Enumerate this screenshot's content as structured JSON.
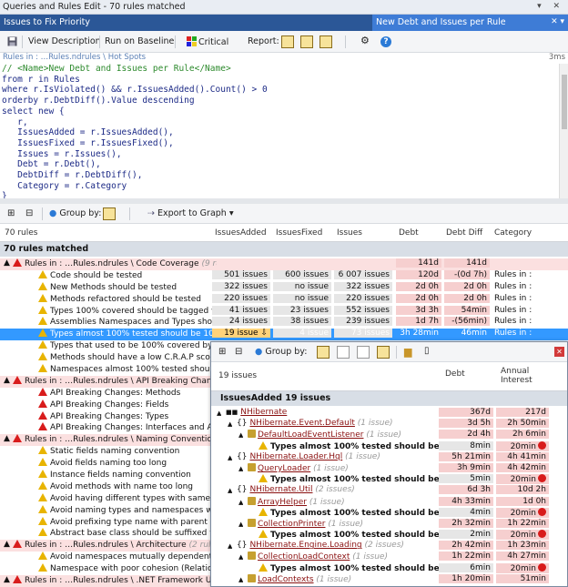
{
  "window": {
    "title": "Queries and Rules Edit  - 70 rules matched",
    "icons": "▾ ✕"
  },
  "tabs": {
    "left": "Issues to Fix Priority",
    "right": "New Debt and Issues per Rule",
    "right_icons": "✕ ▾"
  },
  "toolbar": {
    "save": "",
    "view_description": "View Description",
    "run_on_baseline": "Run on Baseline",
    "critical": "Critical",
    "report": "Report:"
  },
  "breadcrumb": {
    "path": "Rules in : …Rules.ndrules \\ Hot Spots",
    "time": "3ms"
  },
  "code": {
    "lines": [
      {
        "t": "cmt",
        "s": "// <Name>New Debt and Issues per Rule</Name>"
      },
      {
        "t": "",
        "s": "from r in Rules"
      },
      {
        "t": "",
        "s": "where r.IsViolated() && r.IssuesAdded().Count() > 0"
      },
      {
        "t": "",
        "s": "orderby r.DebtDiff().Value descending"
      },
      {
        "t": "",
        "s": "select new {"
      },
      {
        "t": "",
        "s": "   r,"
      },
      {
        "t": "",
        "s": "   IssuesAdded = r.IssuesAdded(),"
      },
      {
        "t": "",
        "s": "   IssuesFixed = r.IssuesFixed(),"
      },
      {
        "t": "",
        "s": "   Issues = r.Issues(),"
      },
      {
        "t": "",
        "s": "   Debt = r.Debt(),"
      },
      {
        "t": "",
        "s": "   DebtDiff = r.DebtDiff(),"
      },
      {
        "t": "",
        "s": "   Category = r.Category"
      },
      {
        "t": "",
        "s": "}"
      }
    ]
  },
  "results_toolbar": {
    "group_by": "Group by:",
    "export": "Export to Graph",
    "export_arrow": "▾"
  },
  "columns": {
    "rules": "70 rules",
    "added": "IssuesAdded",
    "fixed": "IssuesFixed",
    "issues": "Issues",
    "debt": "Debt",
    "debtdiff": "Debt Diff",
    "category": "Category"
  },
  "group_label": "70 rules matched",
  "rows": [
    {
      "ind": 0,
      "exp": "▲",
      "icon": "red",
      "name": "Rules in : …Rules.ndrules \\ Code Coverage",
      "extra": "(9 rules)",
      "a": "",
      "f": "",
      "i": "",
      "d": "141d",
      "dd": "141d",
      "cat": "",
      "pink": true
    },
    {
      "ind": 1,
      "exp": "",
      "icon": "warn",
      "name": "Code should be tested",
      "a": "501 issues",
      "f": "600 issues",
      "i": "6 007 issues",
      "d": "120d",
      "dd": "-(0d 7h)",
      "cat": "Rules in :"
    },
    {
      "ind": 1,
      "exp": "",
      "icon": "warn",
      "name": "New Methods should be tested",
      "a": "322 issues",
      "f": "no issue",
      "i": "322 issues",
      "d": "2d 0h",
      "dd": "2d 0h",
      "cat": "Rules in :"
    },
    {
      "ind": 1,
      "exp": "",
      "icon": "warn",
      "name": "Methods refactored should be tested",
      "a": "220 issues",
      "f": "no issue",
      "i": "220 issues",
      "d": "2d 0h",
      "dd": "2d 0h",
      "cat": "Rules in :"
    },
    {
      "ind": 1,
      "exp": "",
      "icon": "warn",
      "name": "Types 100% covered should be tagged with Fu",
      "a": "41 issues",
      "f": "23 issues",
      "i": "552 issues",
      "d": "3d 3h",
      "dd": "54min",
      "cat": "Rules in :"
    },
    {
      "ind": 1,
      "exp": "",
      "icon": "warn",
      "name": "Assemblies Namespaces and Types should be",
      "a": "24 issues",
      "f": "38 issues",
      "i": "239 issues",
      "d": "1d 7h",
      "dd": "-(56min)",
      "cat": "Rules in :"
    },
    {
      "ind": 1,
      "exp": "",
      "icon": "warn",
      "name": "Types almost 100% tested should be 100% te",
      "a": "19 issue ⇩",
      "f": "4 issue",
      "i": "73 issues",
      "d": "3h 28min",
      "dd": "46min",
      "cat": "Rules in :",
      "sel": true
    },
    {
      "ind": 1,
      "exp": "",
      "icon": "warn",
      "name": "Types that used to be 100% covered by tests s",
      "a": "",
      "f": "",
      "i": "",
      "d": "",
      "dd": "",
      "cat": ""
    },
    {
      "ind": 1,
      "exp": "",
      "icon": "warn",
      "name": "Methods should have a low C.R.A.P score",
      "a": "",
      "f": "",
      "i": "",
      "d": "",
      "dd": "",
      "cat": ""
    },
    {
      "ind": 1,
      "exp": "",
      "icon": "warn",
      "name": "Namespaces almost 100% tested should be 1",
      "a": "",
      "f": "",
      "i": "",
      "d": "",
      "dd": "",
      "cat": ""
    },
    {
      "ind": 0,
      "exp": "▲",
      "icon": "red",
      "name": "Rules in : …Rules.ndrules \\ API Breaking Changes",
      "extra": "",
      "a": "",
      "f": "",
      "i": "",
      "d": "",
      "dd": "",
      "cat": "",
      "pink": true
    },
    {
      "ind": 1,
      "exp": "",
      "icon": "red",
      "name": "API Breaking Changes: Methods",
      "a": "",
      "f": "",
      "i": "",
      "d": "",
      "dd": "",
      "cat": ""
    },
    {
      "ind": 1,
      "exp": "",
      "icon": "red",
      "name": "API Breaking Changes: Fields",
      "a": "",
      "f": "",
      "i": "",
      "d": "",
      "dd": "",
      "cat": ""
    },
    {
      "ind": 1,
      "exp": "",
      "icon": "red",
      "name": "API Breaking Changes: Types",
      "a": "",
      "f": "",
      "i": "",
      "d": "",
      "dd": "",
      "cat": ""
    },
    {
      "ind": 1,
      "exp": "",
      "icon": "red",
      "name": "API Breaking Changes: Interfaces and Abstrac",
      "a": "",
      "f": "",
      "i": "",
      "d": "",
      "dd": "",
      "cat": ""
    },
    {
      "ind": 0,
      "exp": "▲",
      "icon": "red",
      "name": "Rules in : …Rules.ndrules \\ Naming Conventions",
      "extra": "",
      "a": "",
      "f": "",
      "i": "",
      "d": "",
      "dd": "",
      "cat": "",
      "pink": true
    },
    {
      "ind": 1,
      "exp": "",
      "icon": "warn",
      "name": "Static fields naming convention",
      "a": "",
      "f": "",
      "i": "",
      "d": "",
      "dd": "",
      "cat": ""
    },
    {
      "ind": 1,
      "exp": "",
      "icon": "warn",
      "name": "Avoid fields naming too long",
      "a": "",
      "f": "",
      "i": "",
      "d": "",
      "dd": "",
      "cat": ""
    },
    {
      "ind": 1,
      "exp": "",
      "icon": "warn",
      "name": "Instance fields naming convention",
      "a": "",
      "f": "",
      "i": "",
      "d": "",
      "dd": "",
      "cat": ""
    },
    {
      "ind": 1,
      "exp": "",
      "icon": "warn",
      "name": "Avoid methods with name too long",
      "a": "",
      "f": "",
      "i": "",
      "d": "",
      "dd": "",
      "cat": ""
    },
    {
      "ind": 1,
      "exp": "",
      "icon": "warn",
      "name": "Avoid having different types with same name",
      "a": "",
      "f": "",
      "i": "",
      "d": "",
      "dd": "",
      "cat": ""
    },
    {
      "ind": 1,
      "exp": "",
      "icon": "warn",
      "name": "Avoid naming types and namespaces with the s",
      "a": "",
      "f": "",
      "i": "",
      "d": "",
      "dd": "",
      "cat": ""
    },
    {
      "ind": 1,
      "exp": "",
      "icon": "warn",
      "name": "Avoid prefixing type name with parent namespa",
      "a": "",
      "f": "",
      "i": "",
      "d": "",
      "dd": "",
      "cat": ""
    },
    {
      "ind": 1,
      "exp": "",
      "icon": "warn",
      "name": "Abstract base class should be suffixed with Ba",
      "a": "",
      "f": "",
      "i": "",
      "d": "",
      "dd": "",
      "cat": ""
    },
    {
      "ind": 0,
      "exp": "▲",
      "icon": "red",
      "name": "Rules in : …Rules.ndrules \\ Architecture",
      "extra": "(2 rules)",
      "a": "",
      "f": "",
      "i": "",
      "d": "",
      "dd": "",
      "cat": "",
      "pink": true
    },
    {
      "ind": 1,
      "exp": "",
      "icon": "warn",
      "name": "Avoid namespaces mutually dependent",
      "a": "",
      "f": "",
      "i": "",
      "d": "",
      "dd": "",
      "cat": ""
    },
    {
      "ind": 1,
      "exp": "",
      "icon": "warn",
      "name": "Namespace with poor cohesion (RelationalCo",
      "a": "",
      "f": "",
      "i": "",
      "d": "",
      "dd": "",
      "cat": ""
    },
    {
      "ind": 0,
      "exp": "▲",
      "icon": "red",
      "name": "Rules in : …Rules.ndrules \\ .NET Framework Usag",
      "extra": "",
      "a": "",
      "f": "",
      "i": "",
      "d": "",
      "dd": "",
      "cat": "",
      "pink": true
    }
  ],
  "popup": {
    "group_by": "Group by:",
    "columns": {
      "issues": "19 issues",
      "debt": "Debt",
      "annual": "Annual",
      "interest": "Interest"
    },
    "group_label": "IssuesAdded 19 issues",
    "rows": [
      {
        "ind": 0,
        "exp": "▲",
        "sym": "■■",
        "name": "NHibernate",
        "extra": "",
        "d": "367d",
        "ai": "217d",
        "dot": false,
        "style": "u"
      },
      {
        "ind": 1,
        "exp": "▲",
        "sym": "{}",
        "name": "NHibernate.Event.Default",
        "extra": "(1 issue)",
        "d": "3d 5h",
        "ai": "2h 50min",
        "dot": false,
        "style": "u"
      },
      {
        "ind": 2,
        "exp": "▲",
        "sym": "gear",
        "name": "DefaultLoadEventListener",
        "extra": "(1 issue)",
        "d": "2d 4h",
        "ai": "2h 6min",
        "dot": false,
        "style": "u"
      },
      {
        "ind": 3,
        "exp": "",
        "sym": "warn",
        "name": "Types almost 100% tested should be 100",
        "extra": "",
        "d": "8min",
        "ai": "20min",
        "dot": true,
        "style": "b"
      },
      {
        "ind": 1,
        "exp": "▲",
        "sym": "{}",
        "name": "NHibernate.Loader.Hql",
        "extra": "(1 issue)",
        "d": "5h 21min",
        "ai": "4h 41min",
        "dot": false,
        "style": "u"
      },
      {
        "ind": 2,
        "exp": "▲",
        "sym": "gear",
        "name": "QueryLoader",
        "extra": "(1 issue)",
        "d": "3h 9min",
        "ai": "4h 42min",
        "dot": false,
        "style": "u"
      },
      {
        "ind": 3,
        "exp": "",
        "sym": "warn",
        "name": "Types almost 100% tested should be 100",
        "extra": "",
        "d": "5min",
        "ai": "20min",
        "dot": true,
        "style": "b"
      },
      {
        "ind": 1,
        "exp": "▲",
        "sym": "{}",
        "name": "NHibernate.Util",
        "extra": "(2 issues)",
        "d": "6d 3h",
        "ai": "10d 2h",
        "dot": false,
        "style": "u"
      },
      {
        "ind": 2,
        "exp": "▲",
        "sym": "gear",
        "name": "ArrayHelper",
        "extra": "(1 issue)",
        "d": "4h 33min",
        "ai": "1d 0h",
        "dot": false,
        "style": "u"
      },
      {
        "ind": 3,
        "exp": "",
        "sym": "warn",
        "name": "Types almost 100% tested should be 100",
        "extra": "",
        "d": "4min",
        "ai": "20min",
        "dot": true,
        "style": "b"
      },
      {
        "ind": 2,
        "exp": "▲",
        "sym": "gear",
        "name": "CollectionPrinter",
        "extra": "(1 issue)",
        "d": "2h 32min",
        "ai": "1h 22min",
        "dot": false,
        "style": "u"
      },
      {
        "ind": 3,
        "exp": "",
        "sym": "warn",
        "name": "Types almost 100% tested should be 100",
        "extra": "",
        "d": "2min",
        "ai": "20min",
        "dot": true,
        "style": "b"
      },
      {
        "ind": 1,
        "exp": "▲",
        "sym": "{}",
        "name": "NHibernate.Engine.Loading",
        "extra": "(2 issues)",
        "d": "2h 42min",
        "ai": "1h 23min",
        "dot": false,
        "style": "u"
      },
      {
        "ind": 2,
        "exp": "▲",
        "sym": "gear",
        "name": "CollectionLoadContext",
        "extra": "(1 issue)",
        "d": "1h 22min",
        "ai": "4h 27min",
        "dot": false,
        "style": "u"
      },
      {
        "ind": 3,
        "exp": "",
        "sym": "warn",
        "name": "Types almost 100% tested should be 100",
        "extra": "",
        "d": "6min",
        "ai": "20min",
        "dot": true,
        "style": "b"
      },
      {
        "ind": 2,
        "exp": "▲",
        "sym": "gear",
        "name": "LoadContexts",
        "extra": "(1 issue)",
        "d": "1h 20min",
        "ai": "51min",
        "dot": false,
        "style": "u"
      }
    ]
  },
  "colors": {
    "tabbar": "#2b5797",
    "tab_active": "#3e7cd6",
    "selection": "#3399ff",
    "pink": "#fbe0e0"
  }
}
